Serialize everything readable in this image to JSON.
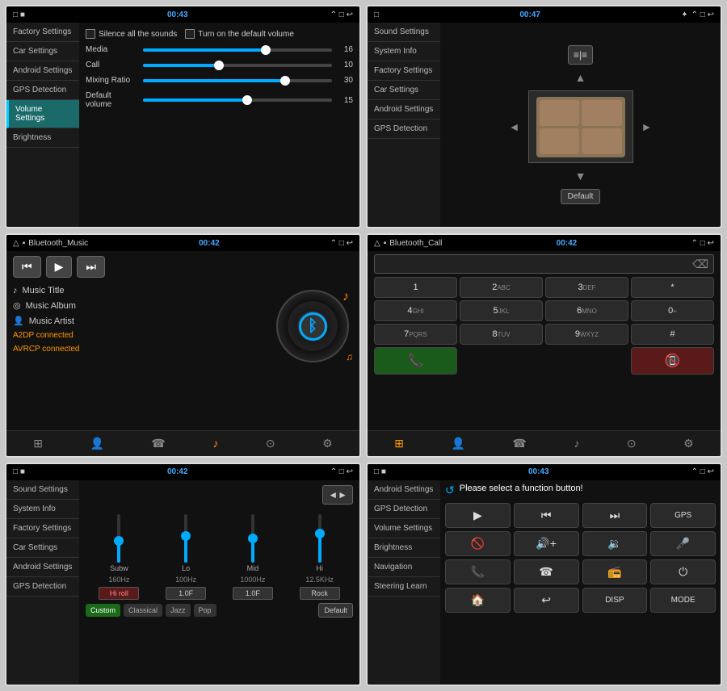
{
  "panels": [
    {
      "id": "volume-settings",
      "statusBar": {
        "left": "□ ■ ■",
        "center": "00:43",
        "right": "⌃ □ ↩"
      },
      "sidebar": {
        "items": [
          {
            "label": "Factory Settings",
            "active": false
          },
          {
            "label": "Car Settings",
            "active": false
          },
          {
            "label": "Android Settings",
            "active": false
          },
          {
            "label": "GPS Detection",
            "active": false
          },
          {
            "label": "Volume Settings",
            "active": true
          },
          {
            "label": "Brightness",
            "active": false
          }
        ]
      },
      "controls": {
        "silence": "Silence all the sounds",
        "defaultVolume": "Turn on the default volume",
        "sliders": [
          {
            "label": "Media",
            "value": 16,
            "pct": 65
          },
          {
            "label": "Call",
            "value": 10,
            "pct": 40
          },
          {
            "label": "Mixing Ratio",
            "value": 30,
            "pct": 75
          },
          {
            "label": "Default volume",
            "value": 15,
            "pct": 55
          }
        ]
      }
    },
    {
      "id": "sound-settings",
      "statusBar": {
        "left": "□",
        "center": "00:47",
        "right": "✦ ⌃ □ ↩"
      },
      "sidebar": {
        "items": [
          {
            "label": "Sound Settings",
            "active": false
          },
          {
            "label": "System Info",
            "active": false
          },
          {
            "label": "Factory Settings",
            "active": false
          },
          {
            "label": "Car Settings",
            "active": false
          },
          {
            "label": "Android Settings",
            "active": false
          },
          {
            "label": "GPS Detection",
            "active": false
          }
        ]
      },
      "defaultBtn": "Default"
    },
    {
      "id": "bluetooth-music",
      "statusBar": {
        "left": "△ ▪",
        "center": "00:42",
        "right": "⌃ □ ↩"
      },
      "appName": "Bluetooth_Music",
      "controls": {
        "prev": "⏮",
        "play": "▶",
        "next": "⏭"
      },
      "info": {
        "title": "Music Title",
        "album": "Music Album",
        "artist": "Music Artist",
        "status1": "A2DP connected",
        "status2": "AVRCP connected"
      },
      "navIcons": [
        "⊞",
        "👤",
        "☎",
        "♪",
        "🔗",
        "⚙"
      ]
    },
    {
      "id": "bluetooth-call",
      "statusBar": {
        "left": "△ ▪",
        "center": "00:42",
        "right": "⌃ □ ↩"
      },
      "appName": "Bluetooth_Call",
      "dialpad": {
        "keys": [
          {
            "main": "1",
            "sub": ""
          },
          {
            "main": "2",
            "sub": "ABC"
          },
          {
            "main": "3",
            "sub": "DEF"
          },
          {
            "main": "*",
            "sub": ""
          },
          {
            "main": "4",
            "sub": "GHI"
          },
          {
            "main": "5",
            "sub": "JKL"
          },
          {
            "main": "6",
            "sub": "MNO"
          },
          {
            "main": "0",
            "sub": "+"
          },
          {
            "main": "7",
            "sub": "PQRS"
          },
          {
            "main": "8",
            "sub": "TUV"
          },
          {
            "main": "9",
            "sub": "WXYZ"
          },
          {
            "main": "#",
            "sub": ""
          }
        ]
      },
      "navIcons": [
        "⊞",
        "👤",
        "☎",
        "♪",
        "🔗",
        "⚙"
      ]
    },
    {
      "id": "eq-settings",
      "statusBar": {
        "left": "□ ■ ■",
        "center": "00:42",
        "right": "⌃ □ ↩"
      },
      "sidebar": {
        "items": [
          {
            "label": "Sound Settings",
            "active": false
          },
          {
            "label": "System Info",
            "active": false
          },
          {
            "label": "Factory Settings",
            "active": false
          },
          {
            "label": "Car Settings",
            "active": false
          },
          {
            "label": "Android Settings",
            "active": false
          },
          {
            "label": "GPS Detection",
            "active": false
          }
        ]
      },
      "eq": {
        "bands": [
          {
            "label": "Subw",
            "pct": 45
          },
          {
            "label": "Lo",
            "pct": 55
          },
          {
            "label": "Mid",
            "pct": 50
          },
          {
            "label": "Hi",
            "pct": 60
          }
        ],
        "freqs": [
          "160Hz",
          "100Hz",
          "1000Hz",
          "12.5KHz"
        ],
        "filters": [
          "Hi roll",
          "1.0F",
          "1.0F",
          "Rock"
        ],
        "presets": [
          "Custom",
          "Classical",
          "Jazz",
          "Pop"
        ],
        "activePreset": "Custom"
      },
      "defaultBtn": "Default"
    },
    {
      "id": "function-select",
      "statusBar": {
        "left": "□ ■ ■",
        "center": "00:43",
        "right": "⌃ □ ↩"
      },
      "sidebar": {
        "items": [
          {
            "label": "Android Settings",
            "active": false
          },
          {
            "label": "GPS Detection",
            "active": false
          },
          {
            "label": "Volume Settings",
            "active": false
          },
          {
            "label": "Brightness",
            "active": false
          },
          {
            "label": "Navigation",
            "active": false
          },
          {
            "label": "Steering Learn",
            "active": false
          }
        ]
      },
      "title": "Please select a function button!",
      "functions": [
        {
          "icon": "▶",
          "text": ""
        },
        {
          "icon": "⏮",
          "text": ""
        },
        {
          "icon": "⏭",
          "text": ""
        },
        {
          "icon": "GPS",
          "text": ""
        },
        {
          "icon": "⊘",
          "text": ""
        },
        {
          "icon": "◄+",
          "text": ""
        },
        {
          "icon": "◄-",
          "text": ""
        },
        {
          "icon": "🎤",
          "text": ""
        },
        {
          "icon": "📞",
          "text": ""
        },
        {
          "icon": "☎",
          "text": ""
        },
        {
          "icon": "📻",
          "text": ""
        },
        {
          "icon": "⏻",
          "text": ""
        },
        {
          "icon": "🏠",
          "text": ""
        },
        {
          "icon": "↩",
          "text": ""
        },
        {
          "icon": "DISP",
          "text": ""
        },
        {
          "icon": "MODE",
          "text": ""
        }
      ]
    }
  ]
}
